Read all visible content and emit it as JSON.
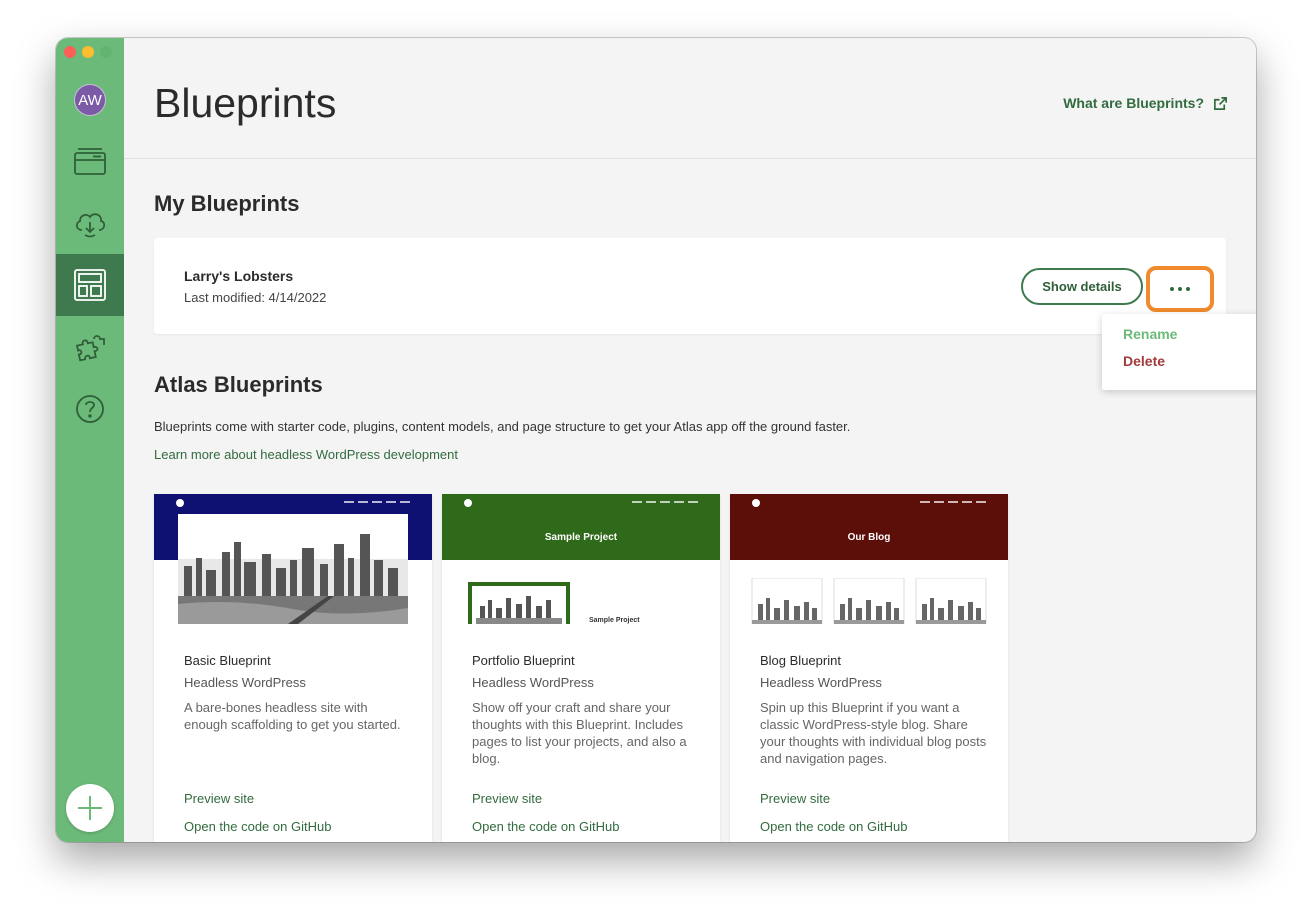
{
  "header": {
    "title": "Blueprints",
    "what_link": "What are Blueprints?"
  },
  "sidebar": {
    "avatar_initials": "AW",
    "items": [
      {
        "name": "sites-icon",
        "active": false
      },
      {
        "name": "cloud-deploy-icon",
        "active": false
      },
      {
        "name": "blueprints-icon",
        "active": true
      },
      {
        "name": "puzzle-icon",
        "active": false
      },
      {
        "name": "help-icon",
        "active": false
      }
    ],
    "add_icon": "plus-icon"
  },
  "my_blueprints": {
    "section_title": "My Blueprints",
    "items": [
      {
        "name": "Larry's Lobsters",
        "modified": "Last modified: 4/14/2022",
        "show_details_label": "Show details"
      }
    ],
    "menu": {
      "rename_label": "Rename",
      "delete_label": "Delete"
    }
  },
  "atlas_blueprints": {
    "section_title": "Atlas Blueprints",
    "description": "Blueprints come with starter code, plugins, content models, and page structure to get your Atlas app off the ground faster.",
    "learn_link": "Learn more about headless WordPress development",
    "cards": [
      {
        "title": "Basic Blueprint",
        "subtitle": "Headless WordPress",
        "description": "A bare-bones headless site with enough scaffolding to get you started.",
        "preview_link": "Preview site",
        "code_link": "Open the code on GitHub",
        "thumb_color": "#0e1172",
        "thumb_heading": ""
      },
      {
        "title": "Portfolio Blueprint",
        "subtitle": "Headless WordPress",
        "description": "Show off your craft and share your thoughts with this Blueprint. Includes pages to list your projects, and also a blog.",
        "preview_link": "Preview site",
        "code_link": "Open the code on GitHub",
        "thumb_color": "#2f6a1a",
        "thumb_heading": "Sample Project",
        "thumb_subheading": "Sample Project"
      },
      {
        "title": "Blog Blueprint",
        "subtitle": "Headless WordPress",
        "description": "Spin up this Blueprint if you want a classic WordPress-style blog. Share your thoughts with individual blog posts and navigation pages.",
        "preview_link": "Preview site",
        "code_link": "Open the code on GitHub",
        "thumb_color": "#5c0f09",
        "thumb_heading": "Our Blog"
      }
    ]
  },
  "colors": {
    "sidebar": "#6cba7a",
    "sidebar_active": "#3f7a4e",
    "link": "#326b3e",
    "highlight": "#f08a2d",
    "delete": "#a23c3c"
  }
}
